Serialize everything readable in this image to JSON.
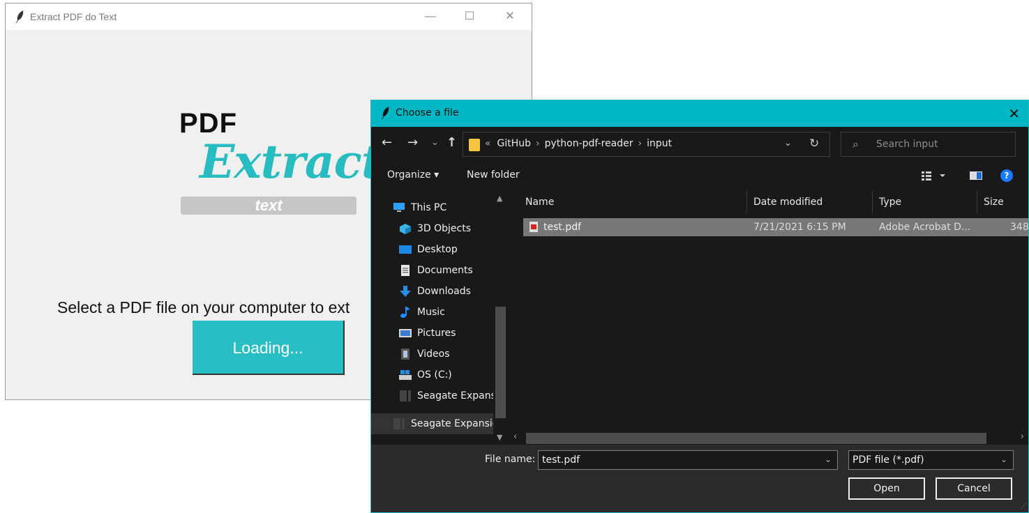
{
  "main_window": {
    "title": "Extract PDF do Text",
    "controls": {
      "minimize": "—",
      "maximize": "☐",
      "close": "✕"
    },
    "logo": {
      "pdf": "PDF",
      "extract": "Extract",
      "text": "text"
    },
    "prompt": "Select a PDF file on your computer to ext",
    "button_label": "Loading..."
  },
  "dialog": {
    "title": "Choose a file",
    "close": "✕",
    "nav": {
      "back": "←",
      "forward": "→",
      "recent": "⌄",
      "up": "↑"
    },
    "breadcrumb": {
      "overflow": "«",
      "items": [
        "GitHub",
        "python-pdf-reader",
        "input"
      ],
      "separator": "›"
    },
    "search_placeholder": "Search input",
    "toolbar": {
      "organize": "Organize ▾",
      "new_folder": "New folder"
    },
    "nav_pane": [
      {
        "label": "This PC",
        "icon": "pc-icon"
      },
      {
        "label": "3D Objects",
        "icon": "cube-icon"
      },
      {
        "label": "Desktop",
        "icon": "desktop-icon"
      },
      {
        "label": "Documents",
        "icon": "documents-icon"
      },
      {
        "label": "Downloads",
        "icon": "download-icon"
      },
      {
        "label": "Music",
        "icon": "music-icon"
      },
      {
        "label": "Pictures",
        "icon": "pictures-icon"
      },
      {
        "label": "Videos",
        "icon": "video-icon"
      },
      {
        "label": "OS (C:)",
        "icon": "drive-icon"
      },
      {
        "label": "Seagate Expansion",
        "icon": "external-drive-icon"
      },
      {
        "label": "Seagate Expansion",
        "icon": "external-drive-icon"
      }
    ],
    "columns": [
      "Name",
      "Date modified",
      "Type",
      "Size"
    ],
    "files": [
      {
        "name": "test.pdf",
        "date": "7/21/2021 6:15 PM",
        "type": "Adobe Acrobat D...",
        "size": "348"
      }
    ],
    "file_name_label": "File name:",
    "file_name_value": "test.pdf",
    "file_type": "PDF file (*.pdf)",
    "open_label": "Open",
    "cancel_label": "Cancel"
  },
  "colors": {
    "accent": "#00b7c3",
    "logo_teal": "#27bdc0",
    "button_teal": "#28bec3",
    "dialog_bg": "#191919",
    "selected_row": "#777777"
  }
}
